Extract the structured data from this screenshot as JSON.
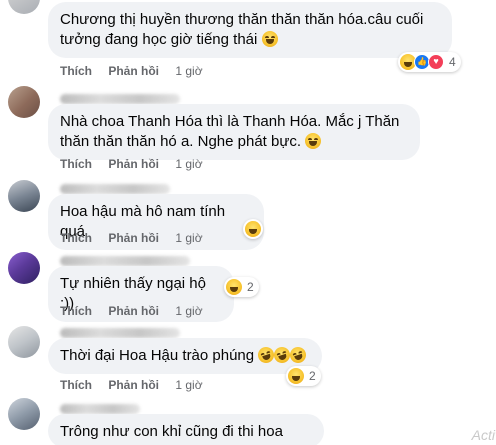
{
  "comments": [
    {
      "text": "Chương thị huyền thương thăn thăn thăn hóa.câu cuối tưởng đang học giờ tiếng thái",
      "actions": {
        "like": "Thích",
        "reply": "Phản hồi",
        "time": "1 giờ"
      },
      "reactions": {
        "types": [
          "haha",
          "like",
          "love"
        ],
        "count": "4"
      }
    },
    {
      "text": "Nhà choa Thanh Hóa thì là Thanh Hóa. Mắc j Thăn thăn thăn thăn hó a. Nghe phát bực.",
      "actions": {
        "like": "Thích",
        "reply": "Phản hồi",
        "time": "1 giờ"
      }
    },
    {
      "text": "Hoa hậu mà hô nam tính quá",
      "actions": {
        "like": "Thích",
        "reply": "Phản hồi",
        "time": "1 giờ"
      },
      "reactions": {
        "types": [
          "haha"
        ],
        "count": ""
      }
    },
    {
      "text": "Tự nhiên thấy ngại hộ :))",
      "actions": {
        "like": "Thích",
        "reply": "Phản hồi",
        "time": "1 giờ"
      },
      "reactions": {
        "types": [
          "haha"
        ],
        "count": "2"
      }
    },
    {
      "text": "Thời đại Hoa Hậu trào phúng",
      "actions": {
        "like": "Thích",
        "reply": "Phản hồi",
        "time": "1 giờ"
      },
      "reactions": {
        "types": [
          "haha"
        ],
        "count": "2"
      }
    },
    {
      "text": "Trông như con khỉ cũng đi thi hoa hậu"
    }
  ],
  "watermark": "Activ",
  "icons": {
    "emoji": "laughing-emoji-icon",
    "haha": "haha-reaction-icon",
    "like": "like-reaction-icon",
    "love": "love-reaction-icon"
  }
}
